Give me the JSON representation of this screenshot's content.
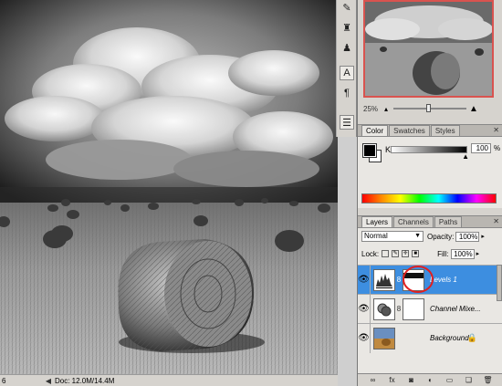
{
  "status": {
    "zoom": "6",
    "doc": "Doc: 12.0M/14.4M"
  },
  "navigator": {
    "zoom": "25%"
  },
  "color_panel": {
    "tabs": [
      "Color",
      "Swatches",
      "Styles"
    ],
    "channel_label": "K",
    "value": "100",
    "unit": "%"
  },
  "layers_panel": {
    "tabs": [
      "Layers",
      "Channels",
      "Paths"
    ],
    "blend_mode": "Normal",
    "opacity_label": "Opacity:",
    "opacity": "100%",
    "lock_label": "Lock:",
    "fill_label": "Fill:",
    "fill": "100%",
    "layers": [
      {
        "name": "Levels 1",
        "selected": true
      },
      {
        "name": "Channel Mixe...",
        "selected": false
      },
      {
        "name": "Background",
        "selected": false
      }
    ]
  },
  "colors": {
    "selection": "#3d8ee0",
    "highlight_circle": "#e02020",
    "navigator_frame": "#d9534f"
  }
}
